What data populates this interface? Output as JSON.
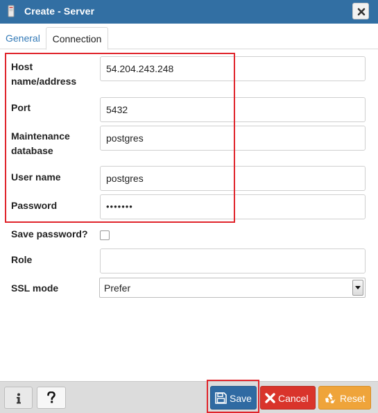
{
  "window": {
    "title": "Create - Server"
  },
  "tabs": [
    {
      "label": "General"
    },
    {
      "label": "Connection"
    }
  ],
  "form": {
    "host": {
      "label_line1": "Host",
      "label_line2": "name/address",
      "value": "54.204.243.248"
    },
    "port": {
      "label": "Port",
      "value": "5432"
    },
    "maintenance_db": {
      "label_line1": "Maintenance",
      "label_line2": "database",
      "value": "postgres"
    },
    "username": {
      "label": "User name",
      "value": "postgres"
    },
    "password": {
      "label": "Password",
      "value": "•••••••"
    },
    "save_password": {
      "label": "Save password?",
      "checked": false
    },
    "role": {
      "label": "Role",
      "value": ""
    },
    "ssl_mode": {
      "label": "SSL mode",
      "value": "Prefer"
    }
  },
  "footer": {
    "save_label": "Save",
    "cancel_label": "Cancel",
    "reset_label": "Reset"
  },
  "colors": {
    "titlebar": "#326fa3",
    "save": "#2f6aa2",
    "cancel": "#d9342b",
    "reset": "#efa43a",
    "highlight": "#e0242b"
  }
}
